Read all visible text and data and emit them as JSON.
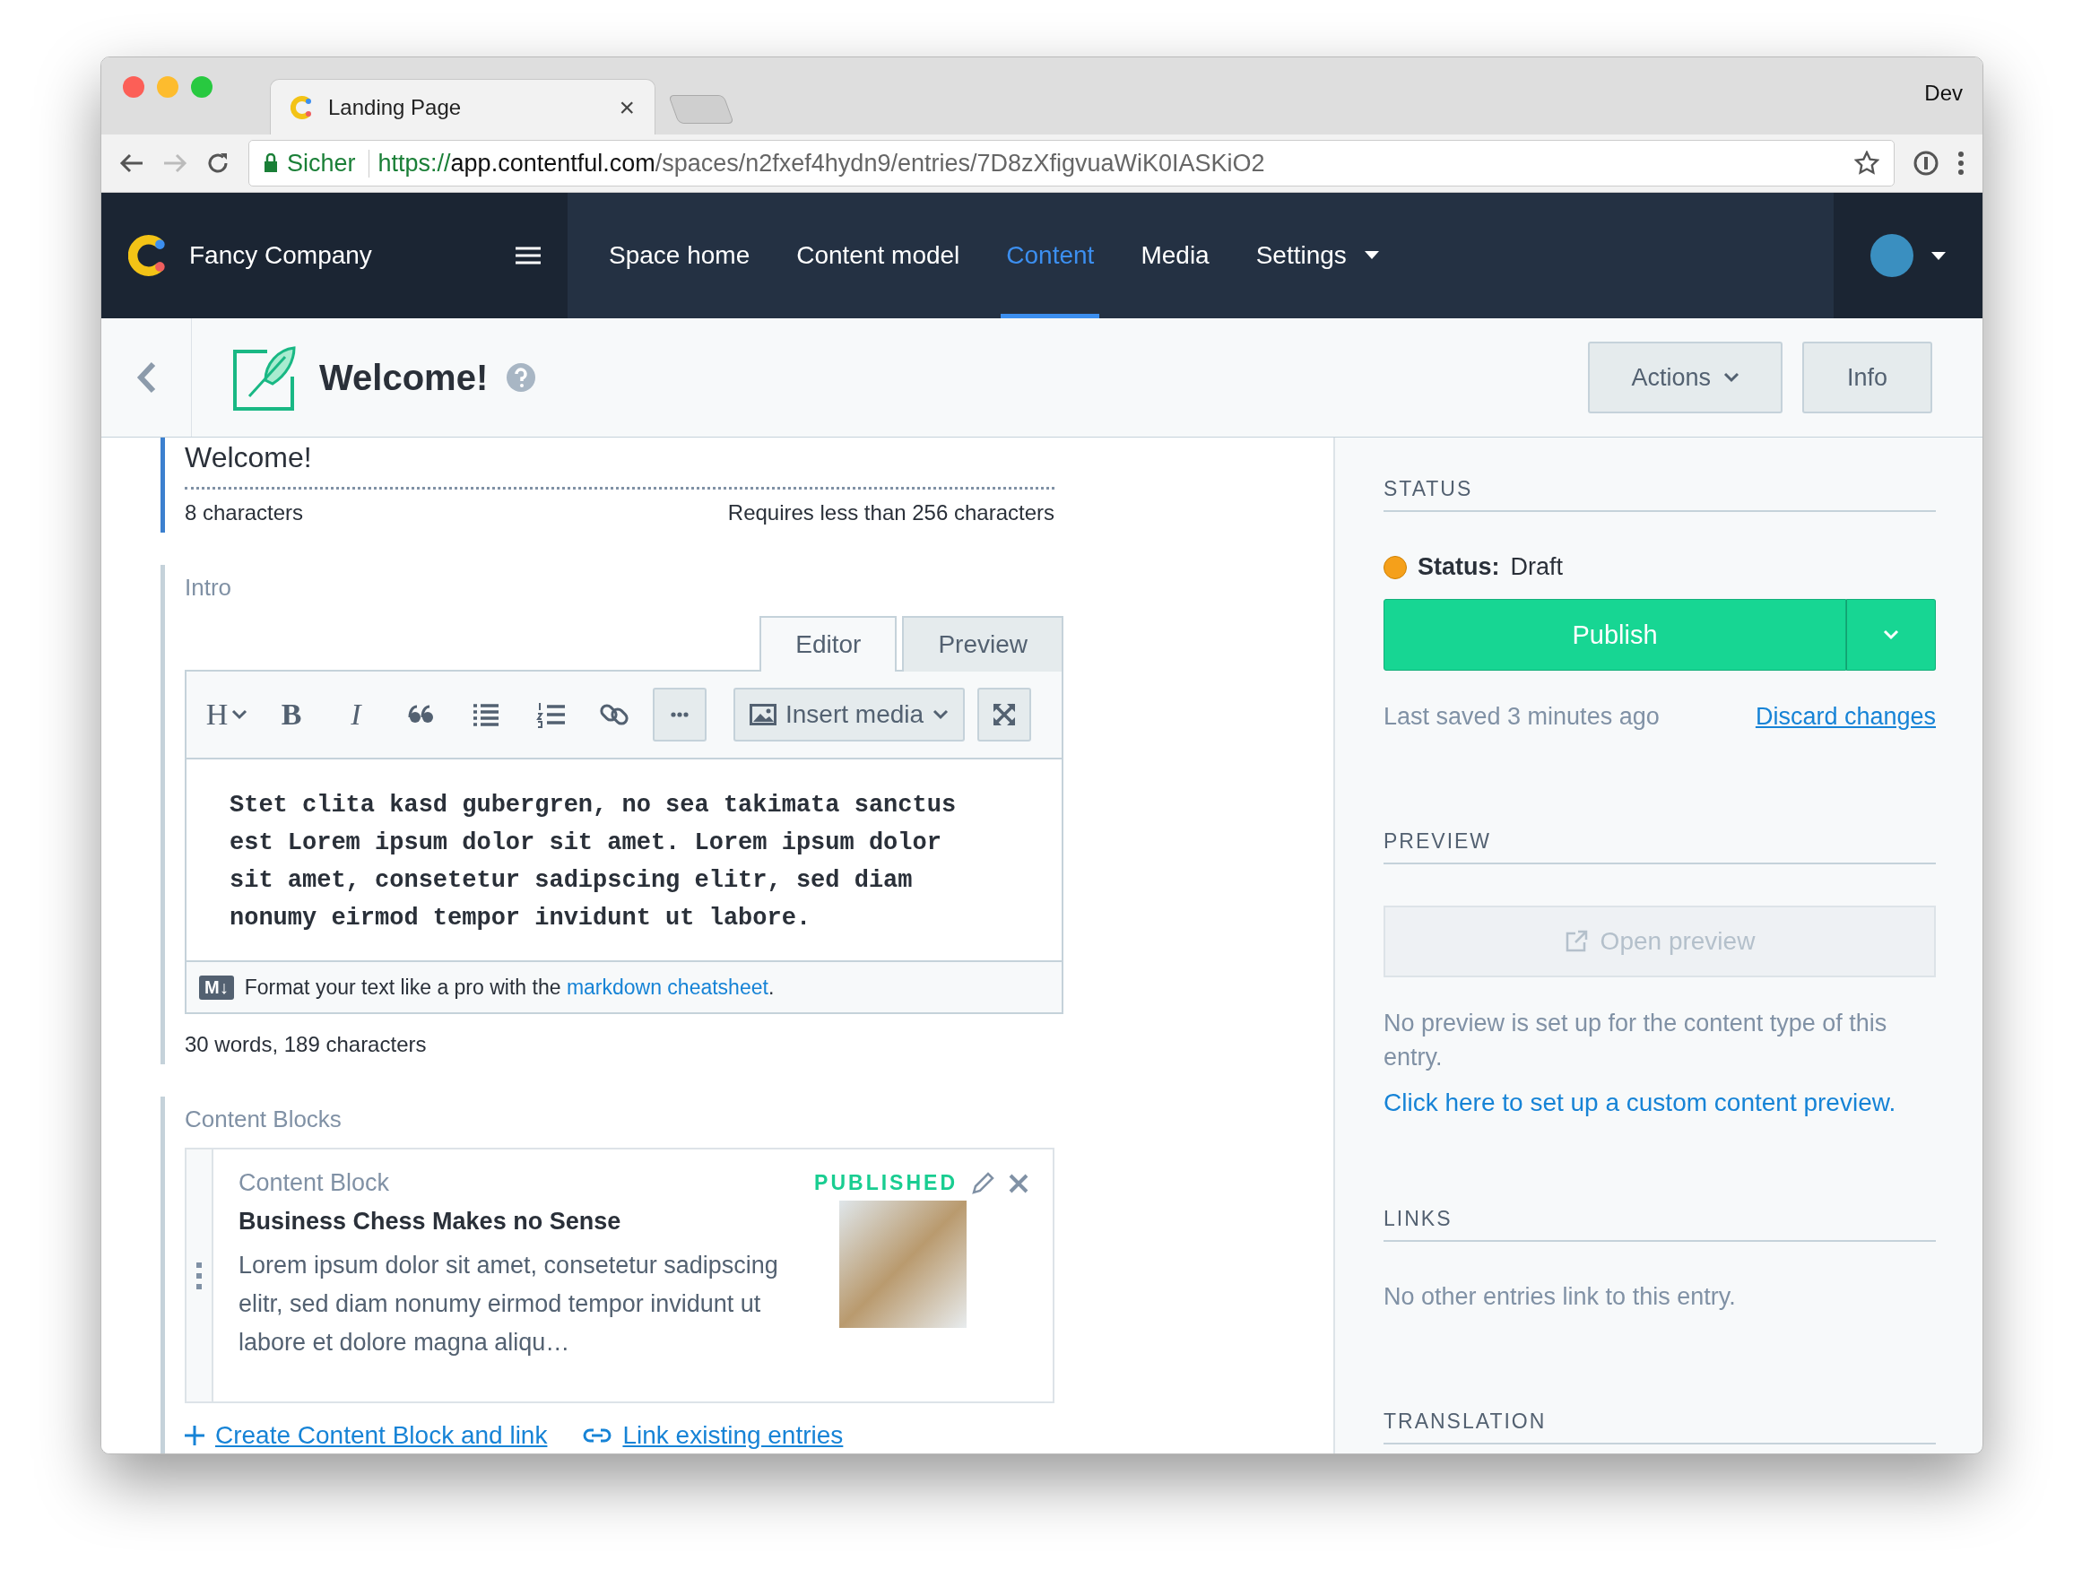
{
  "browser": {
    "tab_title": "Landing Page",
    "tab_close": "×",
    "profile": "Dev",
    "secure_label": "Sicher",
    "url_scheme": "https://",
    "url_host": "app.contentful.com",
    "url_path": "/spaces/n2fxef4hydn9/entries/7D8zXfigvuaWiK0IASKiO2"
  },
  "nav": {
    "brand": "Fancy Company",
    "items": [
      {
        "label": "Space home",
        "selected": false,
        "dropdown": false
      },
      {
        "label": "Content model",
        "selected": false,
        "dropdown": false
      },
      {
        "label": "Content",
        "selected": true,
        "dropdown": false
      },
      {
        "label": "Media",
        "selected": false,
        "dropdown": false
      },
      {
        "label": "Settings",
        "selected": false,
        "dropdown": true
      }
    ]
  },
  "header": {
    "title": "Welcome!",
    "buttons": [
      {
        "label": "Actions",
        "kind": "dropdown"
      },
      {
        "label": "Info",
        "kind": "plain"
      }
    ]
  },
  "title_field": {
    "value": "Welcome!",
    "count": "8 characters",
    "hint": "Requires less than 256 characters"
  },
  "intro": {
    "label": "Intro",
    "tabs": [
      {
        "label": "Editor",
        "selected": true
      },
      {
        "label": "Preview",
        "selected": false
      }
    ],
    "toolbar": {
      "heading": "H",
      "bold": "B",
      "italic": "I",
      "insert_media": "Insert media"
    },
    "body": "Stet clita kasd gubergren, no sea takimata sanctus est Lorem ipsum dolor sit amet. Lorem ipsum dolor sit amet, consetetur sadipscing elitr, sed diam nonumy eirmod tempor invidunt ut labore.",
    "footer": {
      "badge": "M↓",
      "text": "Format your text like a pro with the ",
      "link": "markdown cheatsheet",
      "end": "."
    },
    "count": "30 words, 189 characters"
  },
  "content_blocks": {
    "label": "Content Blocks",
    "cards": [
      {
        "type": "Content Block",
        "status": "PUBLISHED",
        "title": "Business Chess Makes no Sense",
        "description": "Lorem ipsum dolor sit amet, consetetur sadipscing elitr, sed diam nonumy eirmod tempor invidunt ut labore et dolore magna aliqu…"
      }
    ],
    "actions": [
      {
        "label": "Create Content Block and link",
        "kind": "create"
      },
      {
        "label": "Link existing entries",
        "kind": "link"
      }
    ]
  },
  "sidebar": {
    "status": {
      "heading": "STATUS",
      "label": "Status:",
      "value": "Draft",
      "color": "#f5a01a",
      "publish": "Publish",
      "last_saved": "Last saved 3 minutes ago",
      "discard": "Discard changes"
    },
    "preview": {
      "heading": "PREVIEW",
      "button": "Open preview",
      "disabled": true,
      "note": "No preview is set up for the content type of this entry.",
      "link": "Click here to set up a custom content preview."
    },
    "links": {
      "heading": "LINKS",
      "text": "No other entries link to this entry."
    },
    "translation": {
      "heading": "TRANSLATION"
    }
  }
}
